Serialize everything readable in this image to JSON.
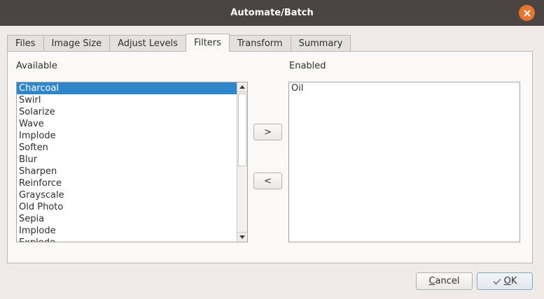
{
  "window": {
    "title": "Automate/Batch"
  },
  "tabs": [
    {
      "label": "Files"
    },
    {
      "label": "Image Size"
    },
    {
      "label": "Adjust Levels"
    },
    {
      "label": "Filters"
    },
    {
      "label": "Transform"
    },
    {
      "label": "Summary"
    }
  ],
  "active_tab": "Filters",
  "available": {
    "label": "Available",
    "selected": "Charcoal",
    "items": [
      "Charcoal",
      "Swirl",
      "Solarize",
      "Wave",
      "Implode",
      "Soften",
      "Blur",
      "Sharpen",
      "Reinforce",
      "Grayscale",
      "Old Photo",
      "Sepia",
      "Implode",
      "Explode"
    ]
  },
  "enabled": {
    "label": "Enabled",
    "items": [
      "Oil"
    ]
  },
  "move_buttons": {
    "add": ">",
    "remove": "<"
  },
  "footer": {
    "cancel_first": "C",
    "cancel_rest": "ancel",
    "ok_first": "O",
    "ok_rest": "K"
  },
  "colors": {
    "titlebar": "#4a4542",
    "close_button": "#e8742f",
    "selection": "#2f86c9"
  },
  "icons": {
    "close": "close-icon",
    "scroll_up": "scroll-up-arrow-icon",
    "scroll_down": "scroll-down-arrow-icon",
    "ok": "checkmark-icon"
  }
}
